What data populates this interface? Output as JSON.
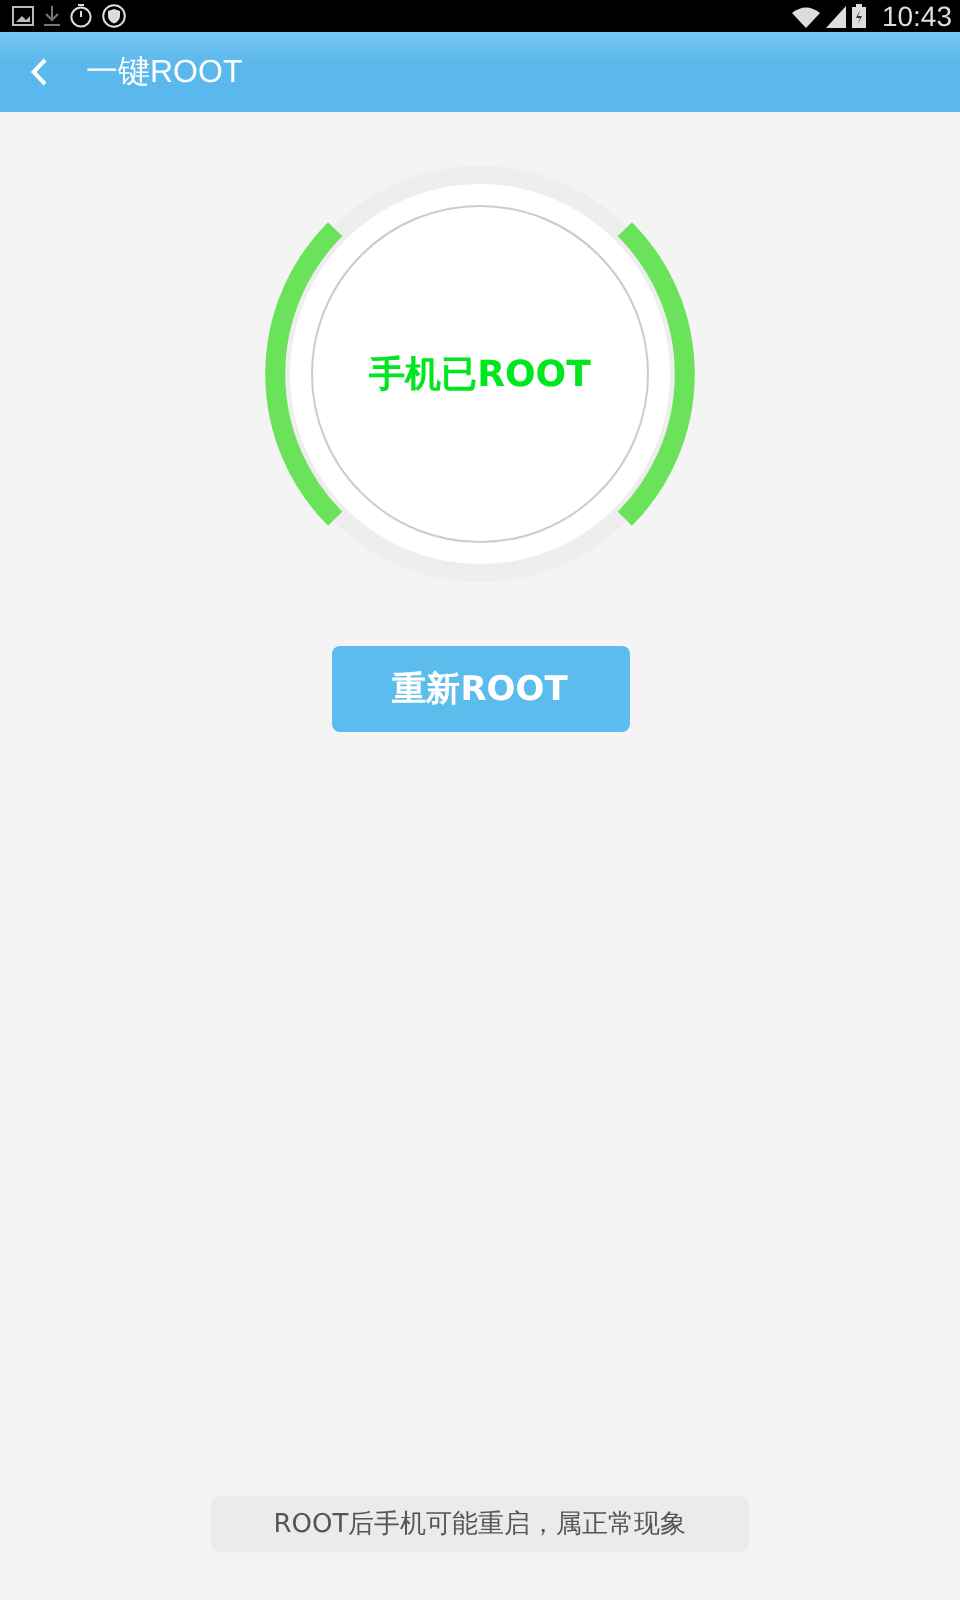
{
  "status_bar": {
    "time": "10:43"
  },
  "app_bar": {
    "title": "一键ROOT"
  },
  "status_ring": {
    "label": "手机已ROOT"
  },
  "action_button": {
    "label": "重新ROOT"
  },
  "toast": {
    "text": "ROOT后手机可能重启，属正常现象"
  }
}
